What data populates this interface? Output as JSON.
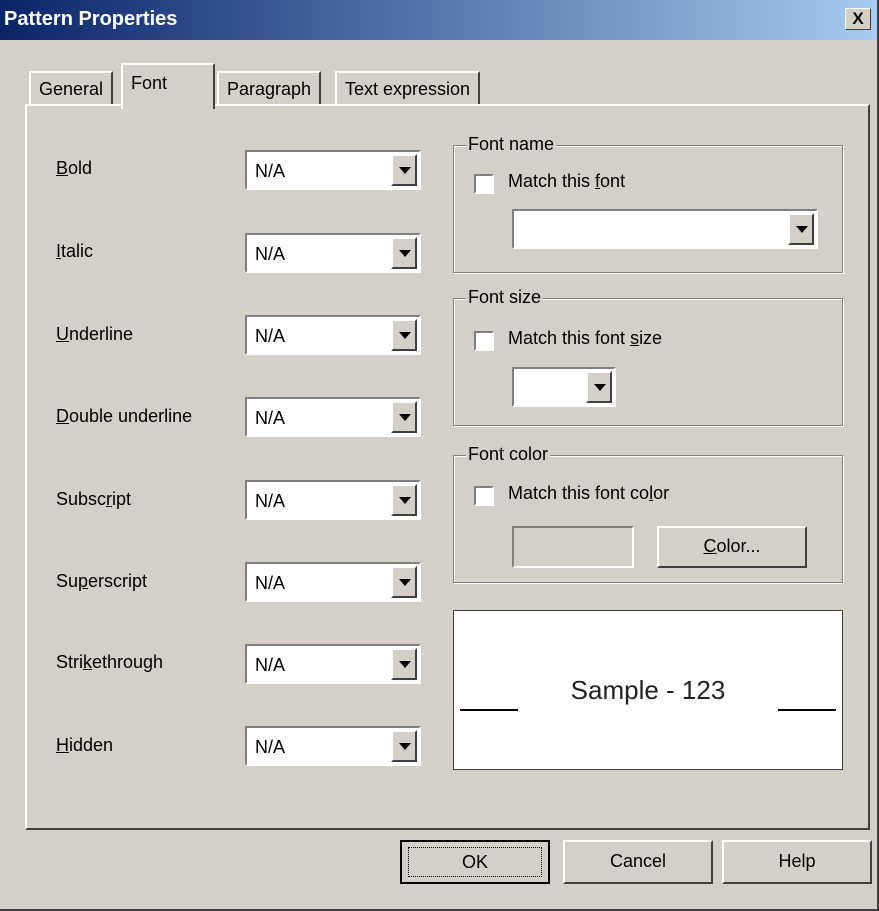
{
  "window": {
    "title": "Pattern Properties",
    "close_label": "X"
  },
  "tabs": [
    {
      "label": "General"
    },
    {
      "label": "Font"
    },
    {
      "label": "Paragraph"
    },
    {
      "label": "Text expression"
    }
  ],
  "attributes": [
    {
      "pre": "",
      "ul": "B",
      "post": "old",
      "value": "N/A"
    },
    {
      "pre": "",
      "ul": "I",
      "post": "talic",
      "value": "N/A"
    },
    {
      "pre": "",
      "ul": "U",
      "post": "nderline",
      "value": "N/A"
    },
    {
      "pre": "",
      "ul": "D",
      "post": "ouble underline",
      "value": "N/A"
    },
    {
      "pre": "Subsc",
      "ul": "r",
      "post": "ipt",
      "value": "N/A"
    },
    {
      "pre": "Su",
      "ul": "p",
      "post": "erscript",
      "value": "N/A"
    },
    {
      "pre": "Stri",
      "ul": "k",
      "post": "ethrough",
      "value": "N/A"
    },
    {
      "pre": "",
      "ul": "H",
      "post": "idden",
      "value": "N/A"
    }
  ],
  "font_name": {
    "title": "Font name",
    "check_pre": "Match this ",
    "check_ul": "f",
    "check_post": "ont",
    "value": ""
  },
  "font_size": {
    "title": "Font size",
    "check_pre": "Match this font ",
    "check_ul": "s",
    "check_post": "ize",
    "value": ""
  },
  "font_color": {
    "title": "Font color",
    "check_pre": "Match this font co",
    "check_ul": "l",
    "check_post": "or",
    "btn_ul": "C",
    "btn_post": "olor..."
  },
  "preview": {
    "text": "Sample - 123"
  },
  "buttons": {
    "ok": "OK",
    "cancel": "Cancel",
    "help": "Help"
  }
}
